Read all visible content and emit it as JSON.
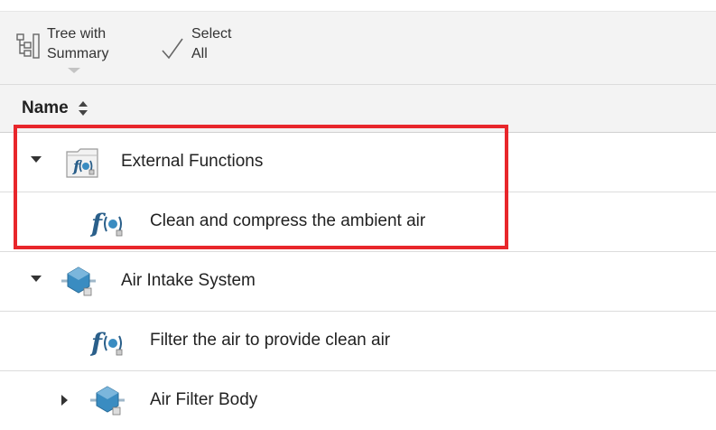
{
  "toolbar": {
    "tree_with_summary": {
      "line1": "Tree with",
      "line2": "Summary",
      "icon": "tree-view-icon"
    },
    "select_all": {
      "line1": "Select",
      "line2": "All",
      "icon": "checkmark-icon"
    }
  },
  "header": {
    "name_label": "Name",
    "sort_icon": "sort-updown-icon"
  },
  "rows": [
    {
      "label": "External Functions",
      "expanded": true,
      "icon": "function-folder-icon",
      "level": 0
    },
    {
      "label": "Clean and compress the ambient air",
      "icon": "function-icon",
      "level": 1
    },
    {
      "label": "Air Intake System",
      "expanded": true,
      "icon": "system-component-icon",
      "level": 0
    },
    {
      "label": "Filter the air to provide clean air",
      "icon": "function-icon",
      "level": 1
    },
    {
      "label": "Air Filter Body",
      "expanded": false,
      "icon": "system-component-icon",
      "level": 1
    }
  ],
  "colors": {
    "highlight": "#e8262b",
    "accent_blue": "#3a8cc1",
    "toolbar_bg": "#f3f3f3"
  }
}
